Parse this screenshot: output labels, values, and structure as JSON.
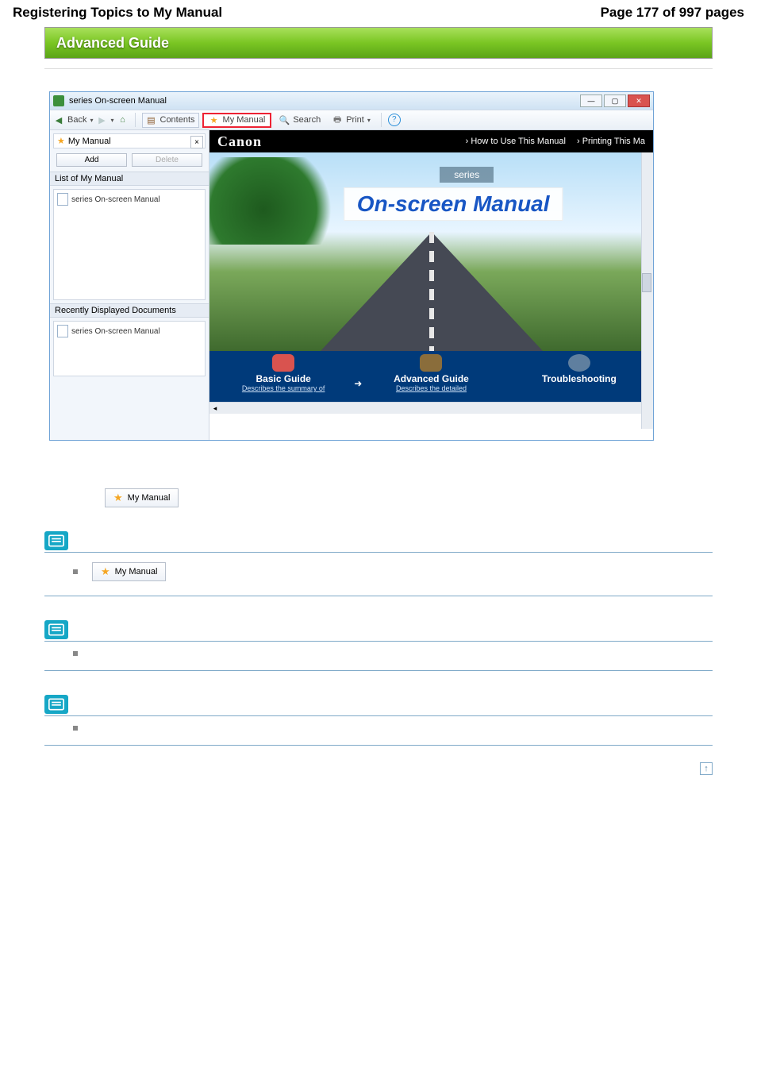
{
  "page": {
    "title_left": "Registering Topics to My Manual",
    "title_right": "Page 177 of 997 pages",
    "guide_bar": "Advanced Guide"
  },
  "window": {
    "title": "series On-screen Manual",
    "toolbar": {
      "back": "Back",
      "contents": "Contents",
      "mymanual": "My Manual",
      "search": "Search",
      "print": "Print"
    },
    "side": {
      "pane_title": "My Manual",
      "add": "Add",
      "delete": "Delete",
      "list_label": "List of My Manual",
      "recent_label": "Recently Displayed Documents",
      "item1": "series On-screen Manual",
      "item2": "series On-screen Manual"
    },
    "content": {
      "brand": "Canon",
      "link1": "How to Use This Manual",
      "link2": "Printing This Ma",
      "series": "series",
      "hero_title": "On-screen Manual",
      "nav": {
        "basic": {
          "title": "Basic Guide",
          "desc": "Describes the summary of"
        },
        "adv": {
          "title": "Advanced Guide",
          "desc": "Describes the detailed"
        },
        "tbl": {
          "title": "Troubleshooting",
          "desc": ""
        }
      }
    }
  },
  "buttons": {
    "mymanual": "My Manual"
  }
}
